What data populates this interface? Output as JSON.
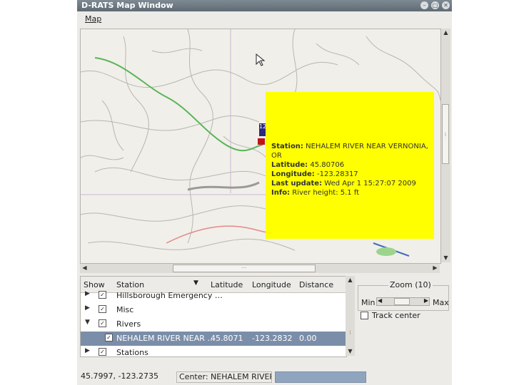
{
  "window": {
    "title": "D-RATS Map Window"
  },
  "menubar": {
    "map_label": "Map"
  },
  "popup": {
    "station_label": "Station:",
    "station_value": "NEHALEM RIVER NEAR VERNONIA, OR",
    "lat_label": "Latitude:",
    "lat_value": "45.80706",
    "lon_label": "Longitude:",
    "lon_value": "-123.28317",
    "update_label": "Last update:",
    "update_value": "Wed Apr  1 15:27:07 2009",
    "info_label": "Info:",
    "info_value": "River height: 5.1 ft"
  },
  "marker": {
    "label": "12"
  },
  "table": {
    "headers": {
      "show": "Show",
      "station": "Station",
      "latitude": "Latitude",
      "longitude": "Longitude",
      "distance": "Distance"
    },
    "rows": [
      {
        "station": "Hillsborough Emergency …",
        "checked": true
      },
      {
        "station": "Misc",
        "checked": true
      },
      {
        "station": "Rivers",
        "checked": true
      },
      {
        "station": "NEHALEM RIVER NEAR …",
        "latitude": "45.8071",
        "longitude": "-123.2832",
        "distance": "0.00",
        "checked": true,
        "selected": true
      },
      {
        "station": "Stations",
        "checked": true
      }
    ]
  },
  "zoom": {
    "label": "Zoom (10)",
    "min": "Min",
    "max": "Max"
  },
  "track_center": {
    "label": "Track center",
    "checked": false
  },
  "statusbar": {
    "coords": "45.7997, -123.2735",
    "center": "Center: NEHALEM RIVER …"
  },
  "colors": {
    "popup": "#ffff00",
    "selection": "#7b8ea9",
    "titlebar": "#6e7a83"
  }
}
